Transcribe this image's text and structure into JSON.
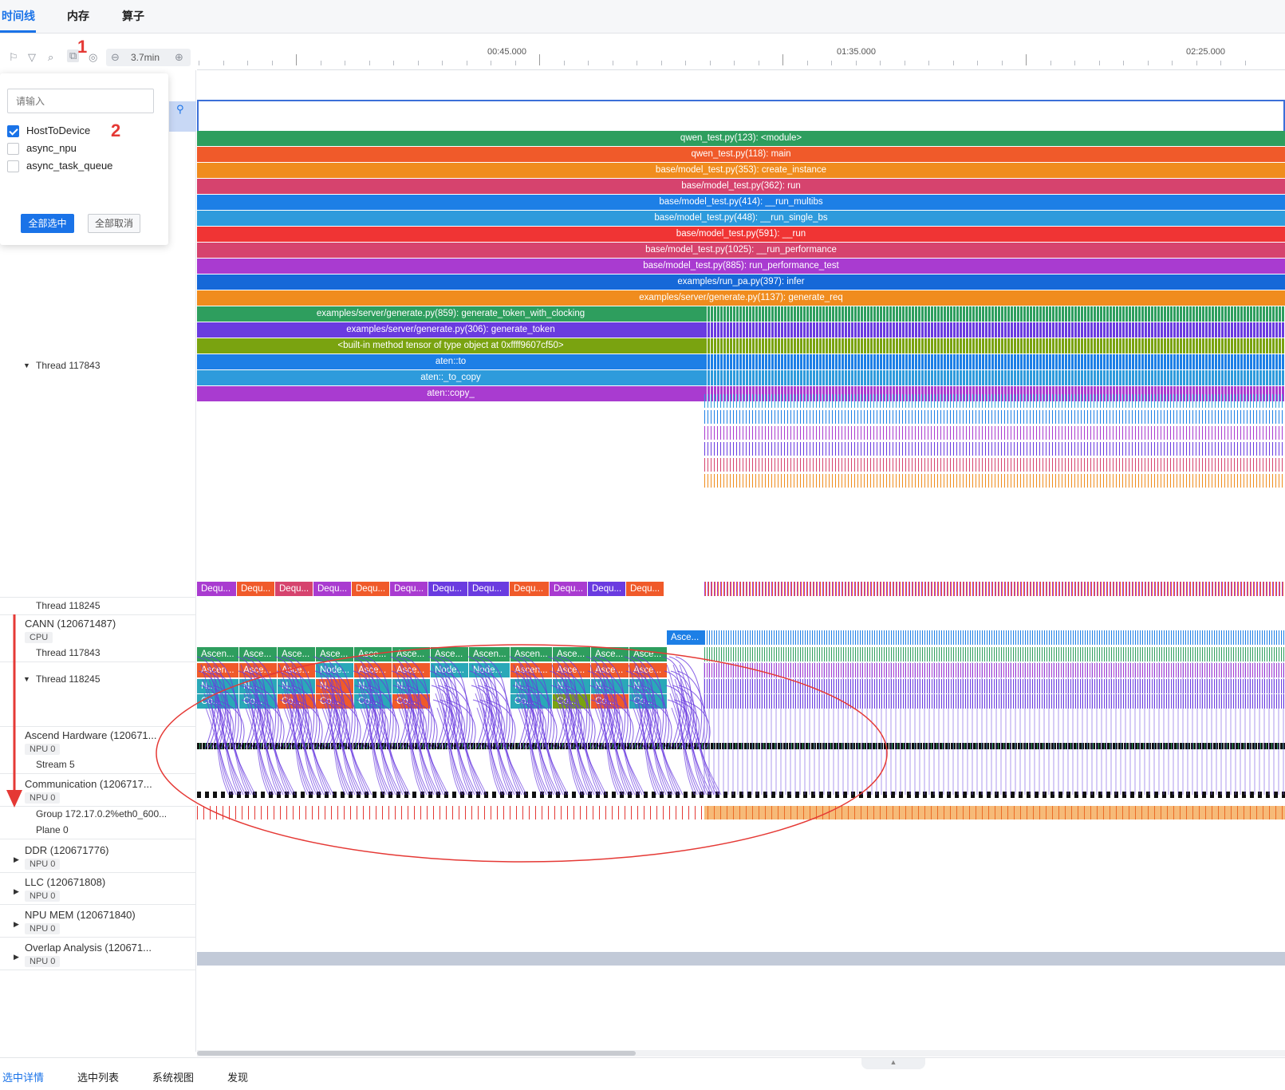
{
  "tabs": [
    {
      "label": "时间线"
    },
    {
      "label": "内存"
    },
    {
      "label": "算子"
    }
  ],
  "toolbar": {
    "zoom_value": "3.7min",
    "zoom_out_icon": "minus-circle-icon",
    "zoom_in_icon": "plus-circle-icon"
  },
  "annotations": {
    "mark1": "1",
    "mark2": "2"
  },
  "ruler": {
    "labels": [
      "00:45.000",
      "01:35.000",
      "02:25.000"
    ]
  },
  "filter_popup": {
    "placeholder": "请输入",
    "options": [
      {
        "label": "HostToDevice",
        "checked": true
      },
      {
        "label": "async_npu",
        "checked": false
      },
      {
        "label": "async_task_queue",
        "checked": false
      }
    ],
    "select_all": "全部选中",
    "deselect_all": "全部取消"
  },
  "thread_rows": {
    "thread_117843_top": "Thread 117843",
    "thread_118245_top": "Thread 118245",
    "cann_group": "CANN (120671487)",
    "cann_tag": "CPU",
    "cann_thread_117843": "Thread 117843",
    "cann_thread_118245": "Thread 118245",
    "ascend_group": "Ascend Hardware (120671...",
    "ascend_tag": "NPU 0",
    "stream": "Stream 5",
    "comm_group": "Communication (1206717...",
    "comm_tag": "NPU 0",
    "comm_group_row": "Group 172.17.0.2%eth0_600...",
    "plane": "Plane 0",
    "ddr_group": "DDR (120671776)",
    "ddr_tag": "NPU 0",
    "llc_group": "LLC (120671808)",
    "llc_tag": "NPU 0",
    "npumem_group": "NPU MEM (120671840)",
    "npumem_tag": "NPU 0",
    "overlap_group": "Overlap Analysis (120671...",
    "overlap_tag": "NPU 0"
  },
  "flame": [
    {
      "label": "qwen_test.py(123): <module>",
      "color": "#2e9e5e"
    },
    {
      "label": "qwen_test.py(118): main",
      "color": "#f05a2a"
    },
    {
      "label": "base/model_test.py(353): create_instance",
      "color": "#f08c1e"
    },
    {
      "label": "base/model_test.py(362): run",
      "color": "#d6436e"
    },
    {
      "label": "base/model_test.py(414): __run_multibs",
      "color": "#1d7fe6"
    },
    {
      "label": "base/model_test.py(448): __run_single_bs",
      "color": "#2e9bdc"
    },
    {
      "label": "base/model_test.py(591): __run",
      "color": "#f03434"
    },
    {
      "label": "base/model_test.py(1025): __run_performance",
      "color": "#d6436e"
    },
    {
      "label": "base/model_test.py(885): run_performance_test",
      "color": "#a93bd0"
    },
    {
      "label": "examples/run_pa.py(397): infer",
      "color": "#1668d8"
    },
    {
      "label": "examples/server/generate.py(1137): generate_req",
      "color": "#f08c1e"
    },
    {
      "label": "examples/server/generate.py(859): generate_token_with_clocking",
      "color": "#2e9e5e"
    },
    {
      "label": "examples/server/generate.py(306): generate_token",
      "color": "#6a3be0"
    },
    {
      "label": "<built-in method tensor of type object at 0xffff9607cf50>",
      "color": "#7aa310"
    },
    {
      "label": "aten::to",
      "color": "#1d7fe6"
    },
    {
      "label": "aten::_to_copy",
      "color": "#2e9bdc"
    },
    {
      "label": "aten::copy_",
      "color": "#a93bd0"
    }
  ],
  "deq_row": {
    "cells": [
      "Dequ...",
      "Dequ...",
      "Dequ...",
      "Dequ...",
      "Dequ...",
      "Dequ...",
      "Dequ...",
      "Dequ...",
      "Dequ...",
      "Dequ...",
      "Dequ...",
      "Dequ..."
    ],
    "colors": [
      "#a93bd0",
      "#f05a2a",
      "#d6436e",
      "#a93bd0",
      "#f05a2a",
      "#a93bd0",
      "#6a3be0",
      "#6a3be0",
      "#f05a2a",
      "#a93bd0",
      "#6a3be0",
      "#f05a2a"
    ]
  },
  "cann_117843_cell": "Asce...",
  "cann_rows": {
    "row1": {
      "cells": [
        "Ascen...",
        "Asce...",
        "Asce...",
        "Asce...",
        "Asce...",
        "Asce...",
        "Asce...",
        "Ascen...",
        "Ascen...",
        "Asce...",
        "Asce...",
        "Asce..."
      ],
      "color": "#2e9e5e"
    },
    "row2": {
      "cells": [
        "Ascen...",
        "Asce...",
        "Asce...",
        "Node...",
        "Asce...",
        "Asce...",
        "Node...",
        "Node...",
        "Ascen...",
        "Asce...",
        "Asce...",
        "Asce..."
      ],
      "colors": [
        "#f05a2a",
        "#f05a2a",
        "#f05a2a",
        "#2aa8b8",
        "#f05a2a",
        "#f05a2a",
        "#2aa8b8",
        "#2aa8b8",
        "#f05a2a",
        "#f05a2a",
        "#f05a2a",
        "#f05a2a"
      ]
    },
    "row3": {
      "cells": [
        "N...",
        "N...",
        "N...",
        "N...",
        "N...",
        "N...",
        "",
        "",
        "N...",
        "N...",
        "N...",
        "N..."
      ],
      "colors": [
        "#2aa8b8",
        "#2aa8b8",
        "#2aa8b8",
        "#f05a2a",
        "#2aa8b8",
        "#2aa8b8",
        "",
        "",
        "#2aa8b8",
        "#2aa8b8",
        "#2aa8b8",
        "#2aa8b8"
      ]
    },
    "row4": {
      "cells": [
        "Co...",
        "Co...",
        "Co...",
        "Co...",
        "Co...",
        "Co...",
        "",
        "",
        "Co...",
        "Co...",
        "Co...",
        "Co..."
      ],
      "colors": [
        "#2aa8b8",
        "#2aa8b8",
        "#f05a2a",
        "#f05a2a",
        "#2aa8b8",
        "#f05a2a",
        "",
        "",
        "#2aa8b8",
        "#7aa310",
        "#f05a2a",
        "#2aa8b8"
      ]
    }
  },
  "bottom_tabs": [
    {
      "label": "选中详情"
    },
    {
      "label": "选中列表"
    },
    {
      "label": "系统视图"
    },
    {
      "label": "发现"
    }
  ]
}
